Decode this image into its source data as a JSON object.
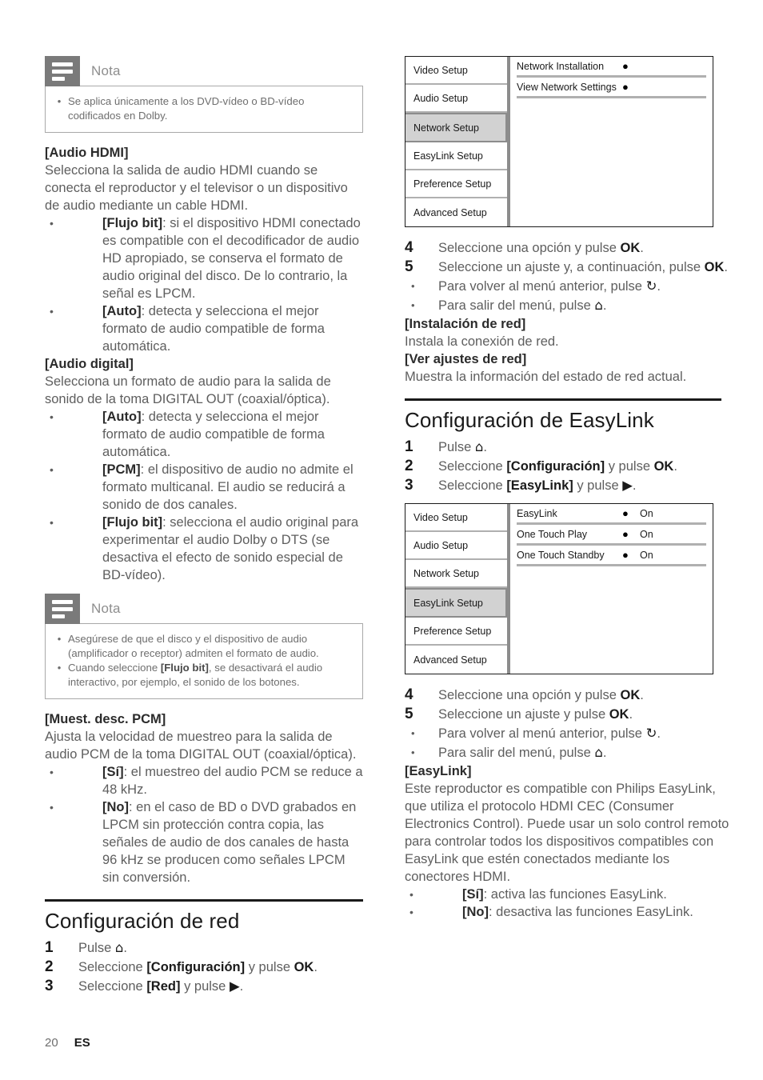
{
  "page": {
    "number": "20",
    "language": "ES"
  },
  "left_column": {
    "note1": {
      "title": "Nota",
      "items": [
        {
          "pre": "Se aplica únicamente a los DVD-vídeo o BD-vídeo codificados en Dolby.",
          "bold": "",
          "post": ""
        }
      ]
    },
    "audio_hdmi": {
      "heading": "[Audio HDMI]",
      "body": "Selecciona la salida de audio HDMI cuando se conecta el reproductor y el televisor o un dispositivo de audio mediante un cable HDMI.",
      "bullets": [
        {
          "bold": "[Flujo bit]",
          "rest": ": si el dispositivo HDMI conectado es compatible con el decodificador de audio HD apropiado, se conserva el formato de audio original del disco. De lo contrario, la señal es LPCM."
        },
        {
          "bold": "[Auto]",
          "rest": ": detecta y selecciona el mejor formato de audio compatible de forma automática."
        }
      ]
    },
    "audio_digital": {
      "heading": "[Audio digital]",
      "body": "Selecciona un formato de audio para la salida de sonido de la toma DIGITAL OUT (coaxial/óptica).",
      "bullets": [
        {
          "bold": "[Auto]",
          "rest": ": detecta y selecciona el mejor formato de audio compatible de forma automática."
        },
        {
          "bold": "[PCM]",
          "rest": ": el dispositivo de audio no admite el formato multicanal. El audio se reducirá a sonido de dos canales."
        },
        {
          "bold": "[Flujo bit]",
          "rest": ": selecciona el audio original para experimentar el audio Dolby o DTS (se desactiva el efecto de sonido especial de BD-vídeo)."
        }
      ]
    },
    "note2": {
      "title": "Nota",
      "item1": "Asegúrese de que el disco y el dispositivo de audio (amplificador o receptor) admiten el formato de audio.",
      "item2_pre": "Cuando seleccione ",
      "item2_bold": "[Flujo bit]",
      "item2_post": ", se desactivará el audio interactivo, por ejemplo, el sonido de los botones."
    },
    "pcm": {
      "heading": "[Muest. desc. PCM]",
      "body": "Ajusta la velocidad de muestreo para la salida de audio PCM de la toma DIGITAL OUT (coaxial/óptica).",
      "bullets": [
        {
          "bold": "[Sí]",
          "rest": ": el muestreo del audio PCM se reduce a 48 kHz."
        },
        {
          "bold": "[No]",
          "rest": ": en el caso de BD o DVD grabados en LPCM sin protección contra copia, las señales de audio de dos canales de hasta 96 kHz se producen como señales LPCM sin conversión."
        }
      ]
    },
    "network_section": {
      "title": "Configuración de red",
      "steps": [
        {
          "num": "1",
          "pre": "Pulse ",
          "glyph": "⌂",
          "post": "."
        },
        {
          "num": "2",
          "pre": "Seleccione ",
          "bold": "[Configuración]",
          "mid": " y pulse ",
          "bold2": "OK",
          "post": "."
        },
        {
          "num": "3",
          "pre": "Seleccione ",
          "bold": "[Red]",
          "mid": " y pulse ",
          "glyph": "▶",
          "post": "."
        }
      ]
    }
  },
  "right_column": {
    "network_menu": {
      "left_items": [
        {
          "label": "Video Setup",
          "selected": false
        },
        {
          "label": "Audio Setup",
          "selected": false
        },
        {
          "label": "Network Setup",
          "selected": true
        },
        {
          "label": "EasyLink Setup",
          "selected": false
        },
        {
          "label": "Preference Setup",
          "selected": false
        },
        {
          "label": "Advanced Setup",
          "selected": false
        }
      ],
      "right_items": [
        {
          "label": "Network Installation",
          "marker": "●",
          "value": ""
        },
        {
          "label": "View Network Settings",
          "marker": "●",
          "value": ""
        }
      ]
    },
    "network_steps": [
      {
        "num": "4",
        "pre": "Seleccione una opción y pulse ",
        "bold": "OK",
        "post": "."
      },
      {
        "num": "5",
        "pre": "Seleccione un ajuste y, a continuación, pulse ",
        "bold": "OK",
        "post": "."
      }
    ],
    "network_substeps": [
      {
        "pre": "Para volver al menú anterior, pulse ",
        "glyph": "↻",
        "post": "."
      },
      {
        "pre": "Para salir del menú, pulse ",
        "glyph": "⌂",
        "post": "."
      }
    ],
    "network_defs": [
      {
        "heading": "[Instalación de red]",
        "body": "Instala la conexión de red."
      },
      {
        "heading": "[Ver ajustes de red]",
        "body": "Muestra la información del estado de red actual."
      }
    ],
    "easylink_section": {
      "title": "Configuración de EasyLink",
      "steps": [
        {
          "num": "1",
          "pre": "Pulse ",
          "glyph": "⌂",
          "post": "."
        },
        {
          "num": "2",
          "pre": "Seleccione ",
          "bold": "[Configuración]",
          "mid": " y pulse ",
          "bold2": "OK",
          "post": "."
        },
        {
          "num": "3",
          "pre": "Seleccione ",
          "bold": "[EasyLink]",
          "mid": " y pulse ",
          "glyph": "▶",
          "post": "."
        }
      ]
    },
    "easylink_menu": {
      "left_items": [
        {
          "label": "Video Setup",
          "selected": false
        },
        {
          "label": "Audio Setup",
          "selected": false
        },
        {
          "label": "Network Setup",
          "selected": false
        },
        {
          "label": "EasyLink Setup",
          "selected": true
        },
        {
          "label": "Preference Setup",
          "selected": false
        },
        {
          "label": "Advanced Setup",
          "selected": false
        }
      ],
      "right_items": [
        {
          "label": "EasyLink",
          "marker": "●",
          "value": "On"
        },
        {
          "label": "One Touch Play",
          "marker": "●",
          "value": "On"
        },
        {
          "label": "One Touch Standby",
          "marker": "●",
          "value": "On"
        }
      ]
    },
    "easylink_steps": [
      {
        "num": "4",
        "pre": "Seleccione una opción y pulse ",
        "bold": "OK",
        "post": "."
      },
      {
        "num": "5",
        "pre": "Seleccione un ajuste y pulse ",
        "bold": "OK",
        "post": "."
      }
    ],
    "easylink_substeps": [
      {
        "pre": "Para volver al menú anterior, pulse ",
        "glyph": "↻",
        "post": "."
      },
      {
        "pre": "Para salir del menú, pulse ",
        "glyph": "⌂",
        "post": "."
      }
    ],
    "easylink_def": {
      "heading": "[EasyLink]",
      "body": "Este reproductor es compatible con Philips EasyLink, que utiliza el protocolo HDMI CEC (Consumer Electronics Control). Puede usar un solo control remoto para controlar todos los dispositivos compatibles con EasyLink que estén conectados mediante los conectores HDMI.",
      "bullets": [
        {
          "bold": "[Sí]",
          "rest": ": activa las funciones EasyLink."
        },
        {
          "bold": "[No]",
          "rest": ": desactiva las funciones EasyLink."
        }
      ]
    }
  }
}
